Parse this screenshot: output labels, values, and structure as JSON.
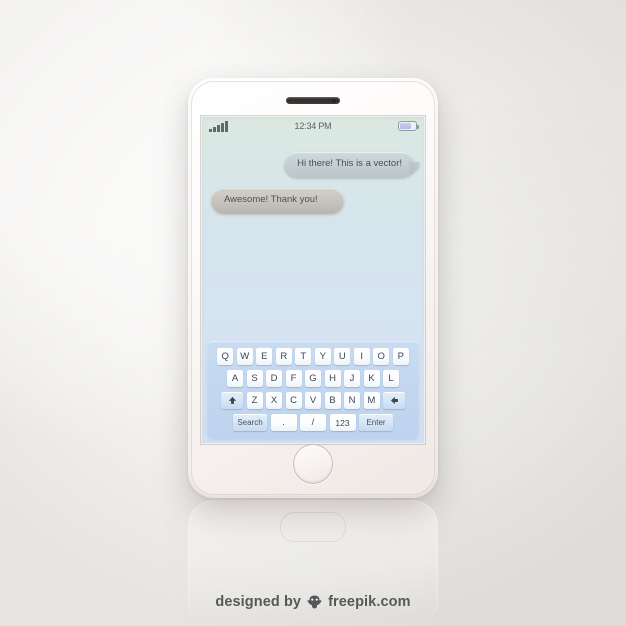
{
  "device": {
    "name": "smartphone-mockup",
    "speaker_icon": "speaker-grille",
    "home_button_icon": "home-button"
  },
  "status_bar": {
    "signal_icon": "signal-bars-icon",
    "signal_bars": 5,
    "time": "12:34 PM",
    "battery_icon": "battery-icon",
    "battery_level_percent": 72
  },
  "conversation": {
    "messages": [
      {
        "text": "Hi there! This is a vector!",
        "side": "right",
        "style": "them"
      },
      {
        "text": "Awesome! Thank you!",
        "side": "left",
        "style": "me"
      }
    ]
  },
  "keyboard": {
    "row1": [
      "Q",
      "W",
      "E",
      "R",
      "T",
      "Y",
      "U",
      "I",
      "O",
      "P"
    ],
    "row2": [
      "A",
      "S",
      "D",
      "F",
      "G",
      "H",
      "J",
      "K",
      "L"
    ],
    "row3": [
      "Z",
      "X",
      "C",
      "V",
      "B",
      "N",
      "M"
    ],
    "shift_icon": "shift-arrow-up-icon",
    "backspace_icon": "backspace-arrow-left-icon",
    "bottom_row": {
      "search": "Search",
      "period": ".",
      "slash": "/",
      "numbers": "123",
      "enter": "Enter"
    }
  },
  "footer": {
    "text_before": "designed by",
    "logo_icon": "freepik-logo-icon",
    "text_after": "freepik.com"
  },
  "colors": {
    "screen_top": "#dce9e1",
    "screen_bottom": "#d3e0f0",
    "keyboard_bg": "#c3d7ef",
    "bubble_them": "#c3ced3",
    "bubble_me": "#c6c2bd",
    "body_bg": "#f2f1ef"
  }
}
